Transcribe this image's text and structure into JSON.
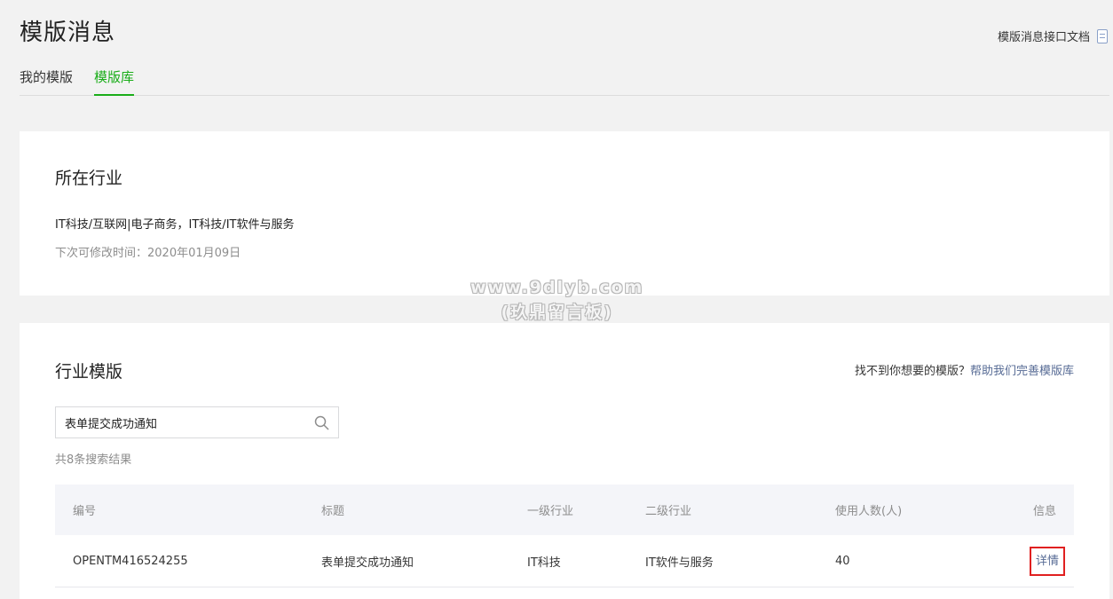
{
  "header": {
    "title": "模版消息",
    "doc_link": "模版消息接口文档",
    "doc_icon": "document-icon"
  },
  "tabs": [
    {
      "label": "我的模版",
      "active": false
    },
    {
      "label": "模版库",
      "active": true
    }
  ],
  "industry_card": {
    "title": "所在行业",
    "industry": "IT科技/互联网|电子商务，IT科技/IT软件与服务",
    "modify_time": "下次可修改时间：2020年01月09日"
  },
  "template_card": {
    "title": "行业模版",
    "help_prefix": "找不到你想要的模版？",
    "help_link": "帮助我们完善模版库",
    "search": {
      "value": "表单提交成功通知",
      "icon": "search-icon"
    },
    "result_count": "共8条搜索结果",
    "table": {
      "headers": [
        "编号",
        "标题",
        "一级行业",
        "二级行业",
        "使用人数(人)",
        "信息"
      ],
      "rows": [
        {
          "id": "OPENTM416524255",
          "title": "表单提交成功通知",
          "industry1": "IT科技",
          "industry2": "IT软件与服务",
          "users": "40",
          "info": "详情"
        }
      ]
    }
  },
  "watermark": {
    "line1": "www.9dlyb.com",
    "line2": "(玖鼎留言板)"
  },
  "colors": {
    "accent": "#1aad19",
    "link": "#576b95",
    "highlight_border": "#e02020"
  }
}
